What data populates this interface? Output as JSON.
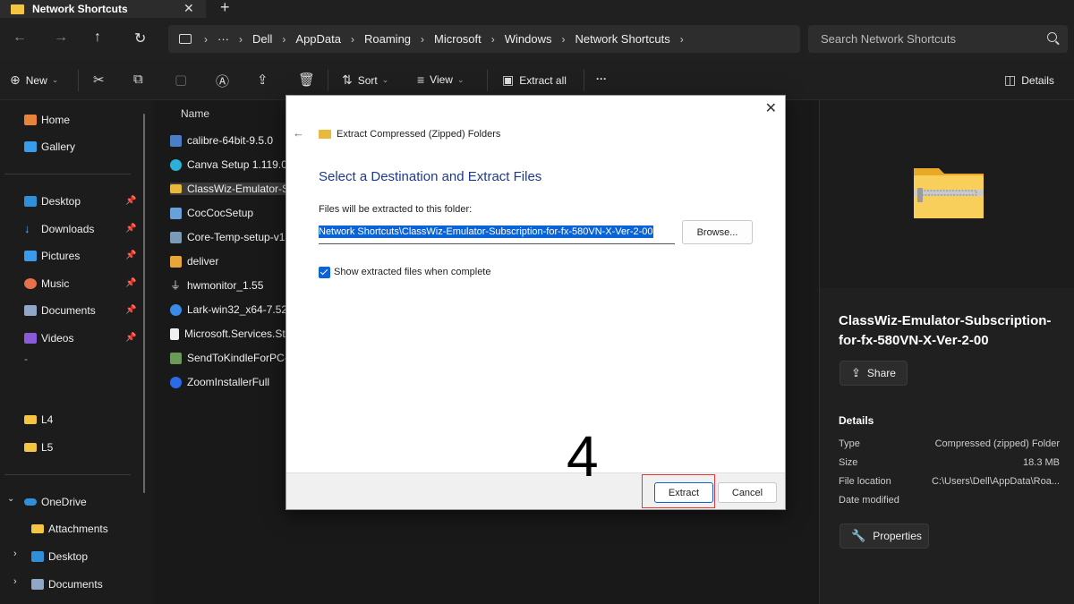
{
  "tab": {
    "title": "Network Shortcuts",
    "close": "✕",
    "add": "+"
  },
  "nav": {
    "back": "←",
    "forward": "→",
    "up": "↑",
    "refresh": "↻"
  },
  "address": {
    "more": "···",
    "crumbs": [
      "Dell",
      "AppData",
      "Roaming",
      "Microsoft",
      "Windows",
      "Network Shortcuts"
    ]
  },
  "search": {
    "placeholder": "Search Network Shortcuts"
  },
  "toolbar": {
    "new_label": "New",
    "sort_label": "Sort",
    "view_label": "View",
    "extract_all_label": "Extract all",
    "more_label": "···",
    "details_label": "Details"
  },
  "sidebar": {
    "home": "Home",
    "gallery": "Gallery",
    "desktop": "Desktop",
    "downloads": "Downloads",
    "pictures": "Pictures",
    "music": "Music",
    "documents": "Documents",
    "videos": "Videos",
    "dash": "-",
    "l4": "L4",
    "l5": "L5",
    "onedrive": "OneDrive",
    "attachments": "Attachments",
    "od_desktop": "Desktop",
    "od_documents": "Documents"
  },
  "files": {
    "column_name": "Name",
    "items": [
      "calibre-64bit-9.5.0",
      "Canva Setup 1.119.0",
      "ClassWiz-Emulator-Su",
      "CocCocSetup",
      "Core-Temp-setup-v1.",
      "deliver",
      "hwmonitor_1.55",
      "Lark-win32_x64-7.52.",
      "Microsoft.Services.Sto",
      "SendToKindleForPC-in",
      "ZoomInstallerFull"
    ]
  },
  "details": {
    "name": "ClassWiz-Emulator-Subscription-for-fx-580VN-X-Ver-2-00",
    "share_label": "Share",
    "heading": "Details",
    "rows": [
      {
        "label": "Type",
        "value": "Compressed (zipped) Folder"
      },
      {
        "label": "Size",
        "value": "18.3 MB"
      },
      {
        "label": "File location",
        "value": "C:\\Users\\Dell\\AppData\\Roa..."
      },
      {
        "label": "Date modified",
        "value": ""
      }
    ],
    "properties_label": "Properties"
  },
  "dialog": {
    "title": "Extract Compressed (Zipped) Folders",
    "heading": "Select a Destination and Extract Files",
    "label": "Files will be extracted to this folder:",
    "path": "Network Shortcuts\\ClassWiz-Emulator-Subscription-for-fx-580VN-X-Ver-2-00",
    "browse_label": "Browse...",
    "show_files_label": "Show extracted files when complete",
    "show_files_checked": true,
    "extract_label": "Extract",
    "cancel_label": "Cancel",
    "close": "✕",
    "back": "←"
  },
  "annotation": {
    "step": "4",
    "highlight_color": "#e03a3a"
  },
  "colors": {
    "accent": "#0a64d8",
    "folder": "#f4c542",
    "heading": "#1e3a8a"
  }
}
